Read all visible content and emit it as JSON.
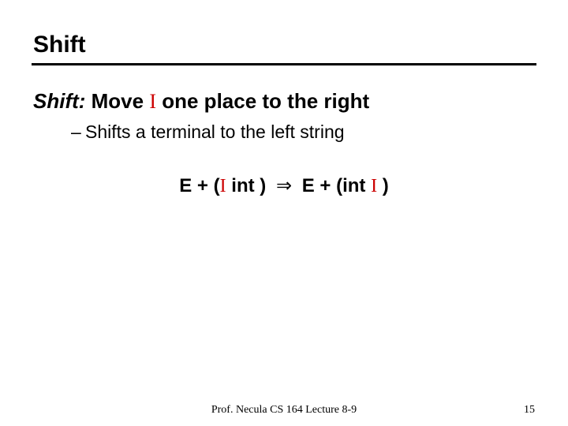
{
  "title": "Shift",
  "definition": {
    "action_word": "Shift:",
    "before_marker": " Move ",
    "marker": "I",
    "after_marker": " one place to the right"
  },
  "subpoint": {
    "dash": "–",
    "text": "Shifts a terminal to the left string"
  },
  "expression": {
    "lhs_pre": "E + (",
    "lhs_marker": "I",
    "lhs_post": " int )",
    "arrow": "⇒",
    "rhs_pre": "E + (int ",
    "rhs_marker": "I",
    "rhs_post": " )"
  },
  "footer": {
    "center": "Prof. Necula  CS 164  Lecture 8-9",
    "page": "15"
  }
}
